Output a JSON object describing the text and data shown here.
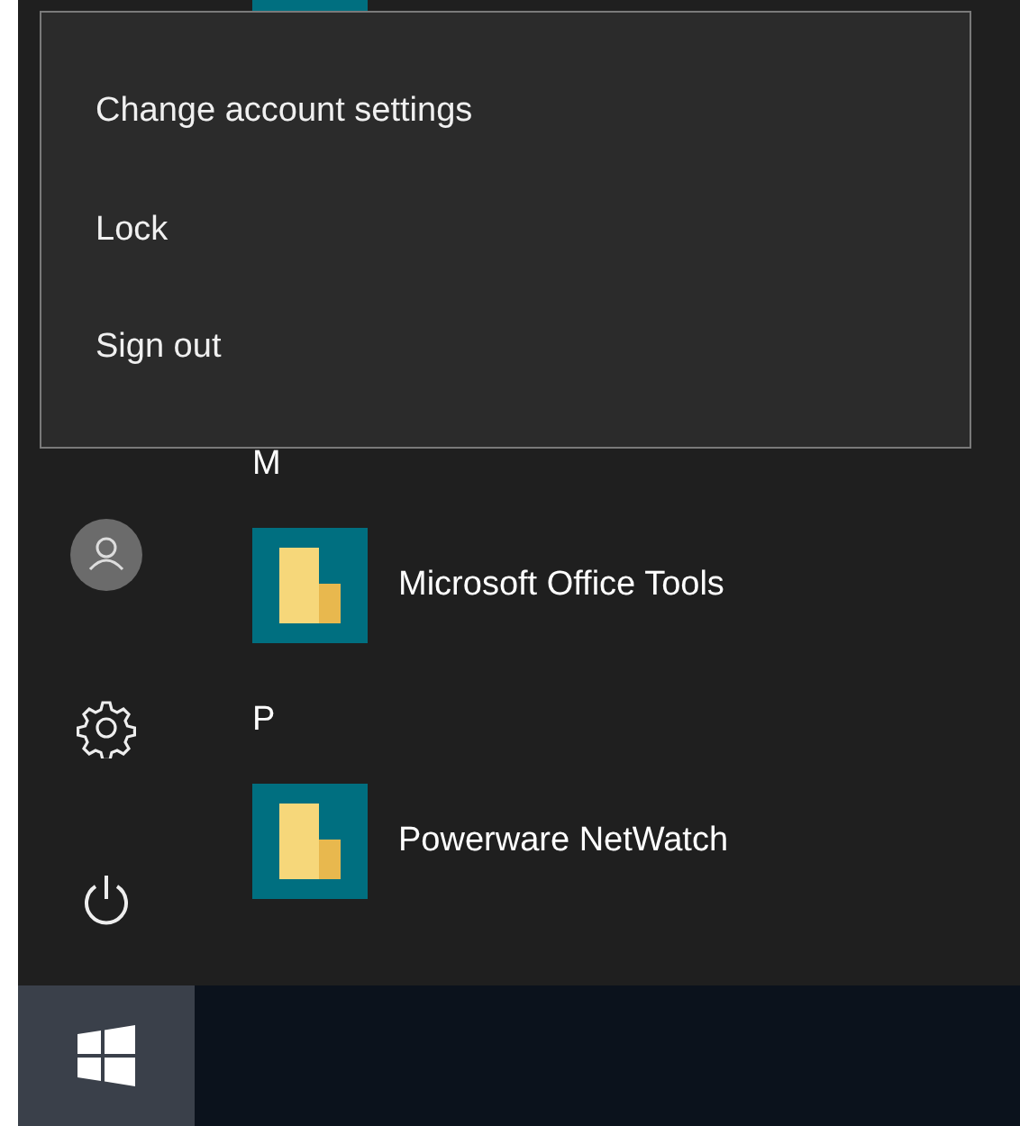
{
  "account_menu": {
    "items": [
      {
        "label": "Change account settings"
      },
      {
        "label": "Lock"
      },
      {
        "label": "Sign out"
      }
    ]
  },
  "app_list": [
    {
      "kind": "header",
      "label": "M"
    },
    {
      "kind": "app",
      "label": "Microsoft Office Tools"
    },
    {
      "kind": "header",
      "label": "P"
    },
    {
      "kind": "app",
      "label": "Powerware NetWatch"
    }
  ]
}
